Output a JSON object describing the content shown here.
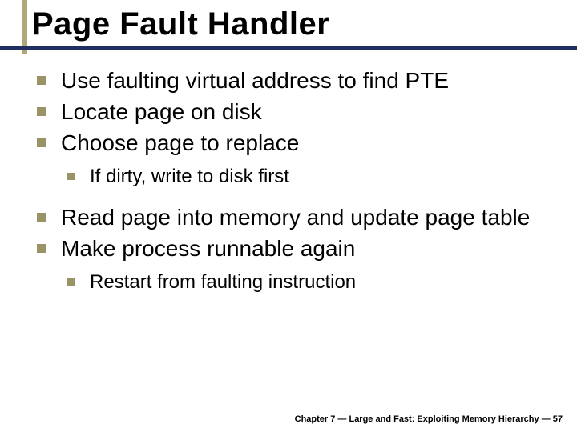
{
  "title": "Page Fault Handler",
  "bullets": {
    "b1": "Use faulting virtual address to find PTE",
    "b2": "Locate page on disk",
    "b3": "Choose page to replace",
    "b3a": "If dirty, write to disk first",
    "b4": "Read page into memory and update page table",
    "b5": "Make process runnable again",
    "b5a": "Restart from faulting instruction"
  },
  "footer": "Chapter 7 — Large and Fast: Exploiting Memory Hierarchy — 57"
}
